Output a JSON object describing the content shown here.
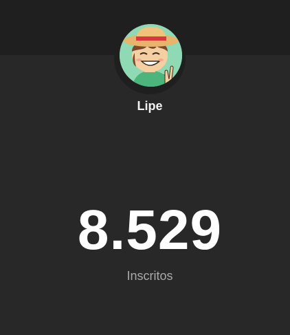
{
  "channel": {
    "name": "Lipe",
    "avatar_icon": "cartoon-boy-straw-hat-avatar"
  },
  "subscribers": {
    "count": "8.529",
    "label": "Inscritos"
  },
  "colors": {
    "background": "#282828",
    "top_band": "#1f1f1f",
    "count_text": "#ffffff",
    "label_text": "#aaaaaa"
  }
}
